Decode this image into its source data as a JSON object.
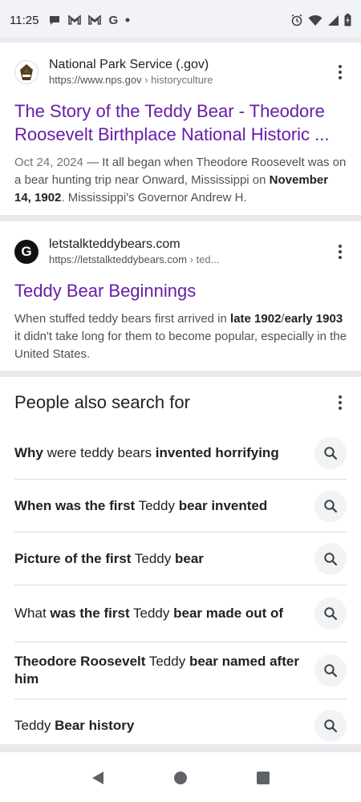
{
  "status_bar": {
    "time": "11:25",
    "left_icons": [
      "chat-icon",
      "gmail-icon",
      "gmail-icon",
      "google-icon",
      "dot-icon"
    ],
    "google_letter": "G",
    "right_icons": [
      "alarm-icon",
      "wifi-icon",
      "signal-icon",
      "battery-icon"
    ]
  },
  "results": [
    {
      "site_name": "National Park Service (.gov)",
      "url": "https://www.nps.gov",
      "breadcrumb": " › historyculture",
      "title": "The Story of the Teddy Bear - Theodore Roosevelt Birthplace National Historic ...",
      "snippet": {
        "date": "Oct 24, 2024",
        "dash": " — ",
        "part1": "It all began when Theodore Roosevelt was on a bear hunting trip near Onward, Mississippi on ",
        "bold1": "November 14, 1902",
        "part2": ". Mississippi's Governor Andrew H."
      }
    },
    {
      "site_name": "letstalkteddybears.com",
      "url": "https://letstalkteddybears.com",
      "breadcrumb": " › ted...",
      "favicon_letter": "G",
      "title": "Teddy Bear Beginnings",
      "snippet": {
        "part1": "When stuffed teddy bears first arrived in ",
        "bold1": "late 1902",
        "sep": "/",
        "bold2": "early 1903",
        "part2": " it didn't take long for them to become popular, especially in the United States."
      }
    }
  ],
  "people_also_search": {
    "title": "People also search for",
    "items": [
      {
        "parts": [
          {
            "t": "Why",
            "b": true
          },
          {
            "t": " were teddy bears ",
            "b": false
          },
          {
            "t": "invented horrifying",
            "b": true
          }
        ]
      },
      {
        "parts": [
          {
            "t": "When was the first",
            "b": true
          },
          {
            "t": " Teddy ",
            "b": false
          },
          {
            "t": "bear invented",
            "b": true
          }
        ]
      },
      {
        "parts": [
          {
            "t": "Picture of the first",
            "b": true
          },
          {
            "t": " Teddy ",
            "b": false
          },
          {
            "t": "bear",
            "b": true
          }
        ]
      },
      {
        "parts": [
          {
            "t": "What ",
            "b": false
          },
          {
            "t": "was the first",
            "b": true
          },
          {
            "t": " Teddy ",
            "b": false
          },
          {
            "t": "bear made out of",
            "b": true
          }
        ]
      },
      {
        "parts": [
          {
            "t": "Theodore Roosevelt",
            "b": true
          },
          {
            "t": " Teddy ",
            "b": false
          },
          {
            "t": "bear named after him",
            "b": true
          }
        ]
      },
      {
        "parts": [
          {
            "t": "Teddy ",
            "b": false
          },
          {
            "t": "Bear history",
            "b": true
          }
        ]
      }
    ]
  },
  "nav_bar": {
    "buttons": [
      "back-icon",
      "home-icon",
      "recents-icon"
    ]
  },
  "colors": {
    "visited_link": "#681da8",
    "status_bar_bg": "#f1f3f8",
    "divider_band": "#e8eaed",
    "search_chip_bg": "#f1f3f4"
  }
}
